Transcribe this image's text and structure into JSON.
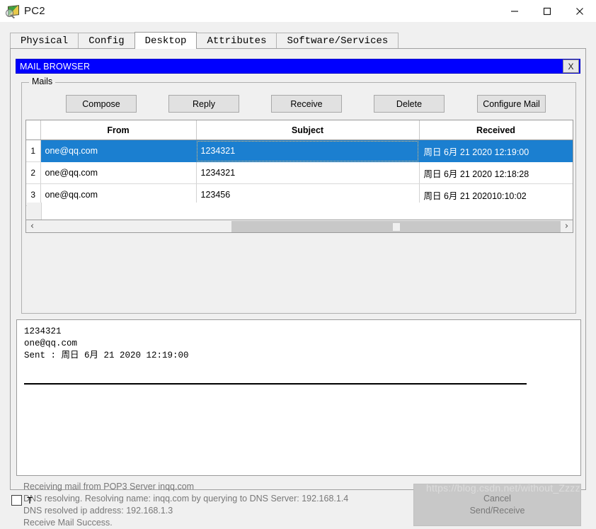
{
  "window": {
    "title": "PC2",
    "icon": "packet-tracer-device-icon",
    "controls": {
      "minimize": "—",
      "maximize": "□",
      "close": "✕"
    }
  },
  "tabs": [
    {
      "label": "Physical",
      "active": false
    },
    {
      "label": "Config",
      "active": false
    },
    {
      "label": "Desktop",
      "active": true
    },
    {
      "label": "Attributes",
      "active": false
    },
    {
      "label": "Software/Services",
      "active": false
    }
  ],
  "mail_browser": {
    "title": "MAIL BROWSER",
    "title_bg": "#0000ff",
    "close_label": "X",
    "group_legend": "Mails",
    "buttons": [
      {
        "label": "Compose"
      },
      {
        "label": "Reply"
      },
      {
        "label": "Receive"
      },
      {
        "label": "Delete"
      },
      {
        "label": "Configure Mail"
      }
    ],
    "table": {
      "headers": [
        "",
        "From",
        "Subject",
        "Received"
      ],
      "selection_color": "#1b7fd0",
      "rows": [
        {
          "index": "1",
          "from": "one@qq.com",
          "subject": "1234321",
          "received": "周日 6月 21 2020 12:19:00",
          "selected": true
        },
        {
          "index": "2",
          "from": "one@qq.com",
          "subject": "1234321",
          "received": "周日 6月 21 2020 12:18:28",
          "selected": false
        },
        {
          "index": "3",
          "from": "one@qq.com",
          "subject": "123456",
          "received": "周日 6月 21 202010:10:02",
          "selected": false
        }
      ]
    },
    "scrollbar": {
      "left_arrow": "‹",
      "right_arrow": "›"
    },
    "message": {
      "subject": "1234321",
      "sender": "one@qq.com",
      "sent": "Sent : 周日 6月 21 2020 12:19:00"
    },
    "status": {
      "lines": [
        "Receiving mail from POP3 Server inqq.com",
        "DNS resolving. Resolving name: inqq.com by querying to DNS Server: 192.168.1.4",
        "DNS resolved ip address: 192.168.1.3",
        "Receive Mail Success."
      ],
      "cancel_button": {
        "line1": "Cancel",
        "line2": "Send/Receive",
        "enabled": false
      }
    }
  },
  "bottom_bar": {
    "checkbox_label": "T"
  },
  "watermark": "https://blog.csdn.net/without_Zzzz"
}
